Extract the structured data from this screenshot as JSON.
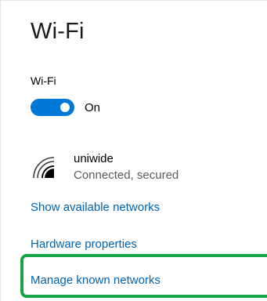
{
  "page": {
    "title": "Wi-Fi"
  },
  "wifi_toggle": {
    "label": "Wi-Fi",
    "state_label": "On",
    "is_on": true,
    "on_color": "#0078d7"
  },
  "network": {
    "icon": "wifi-signal-icon",
    "name": "uniwide",
    "status": "Connected, secured"
  },
  "links": {
    "show_available": "Show available networks",
    "hardware_properties": "Hardware properties",
    "manage_known": "Manage known networks"
  },
  "colors": {
    "link": "#0063b1",
    "highlight": "#1aa247"
  }
}
